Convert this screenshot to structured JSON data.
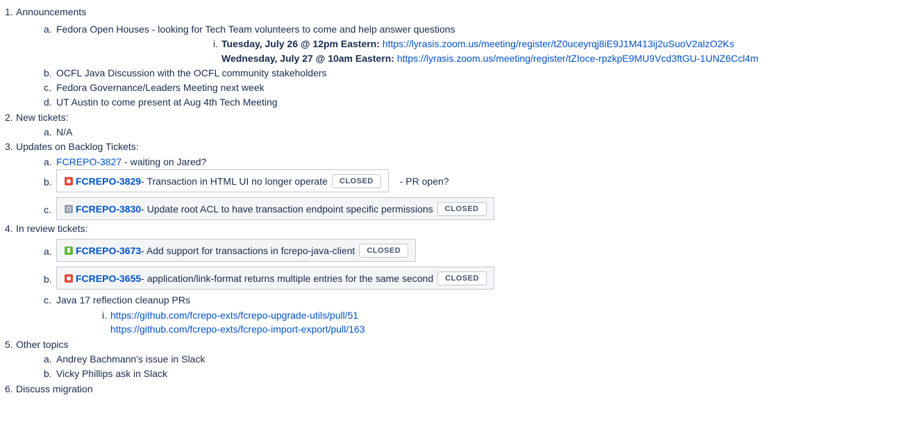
{
  "agenda": {
    "item1": {
      "num": "1.",
      "label": "Announcements",
      "a": {
        "num": "a.",
        "text": "Fedora Open Houses - looking for Tech Team volunteers to come and help answer questions"
      },
      "i": {
        "num": "i.",
        "tuesday_label": "Tuesday, July 26 @ 12pm Eastern:",
        "tuesday_url": "https://lyrasis.zoom.us/meeting/register/tZ0uceyrqj8iE9J1M413ij2uSuoV2alzO2Ks",
        "wednesday_label": "Wednesday, July 27 @ 10am Eastern:",
        "wednesday_url": "https://lyrasis.zoom.us/meeting/register/tZIoce-rpzkpE9MU9Vcd3ftGU-1UNZ6Ccl4m"
      },
      "b": {
        "num": "b.",
        "text": "OCFL Java Discussion with the OCFL community stakeholders"
      },
      "c": {
        "num": "c.",
        "text": "Fedora Governance/Leaders Meeting next week"
      },
      "d": {
        "num": "d.",
        "text": "UT Austin to come present at Aug 4th Tech Meeting"
      }
    },
    "item2": {
      "num": "2.",
      "label": "New tickets:",
      "a": {
        "num": "a.",
        "text": "N/A"
      }
    },
    "item3": {
      "num": "3.",
      "label": "Updates on Backlog Tickets:",
      "a": {
        "num": "a.",
        "key": "FCREPO-3827",
        "text": " - waiting on Jared?"
      },
      "b": {
        "num": "b.",
        "key": "FCREPO-3829",
        "summary": " - Transaction in HTML UI no longer operate",
        "status": "CLOSED",
        "after": "- PR open?"
      },
      "c": {
        "num": "c.",
        "key": "FCREPO-3830",
        "summary": " - Update root ACL to have transaction endpoint specific permissions",
        "status": "CLOSED"
      }
    },
    "item4": {
      "num": "4.",
      "label": "In review tickets:",
      "a": {
        "num": "a.",
        "key": "FCREPO-3673",
        "summary": " - Add support for transactions in fcrepo-java-client",
        "status": "CLOSED"
      },
      "b": {
        "num": "b.",
        "key": "FCREPO-3655",
        "summary": " - application/link-format returns multiple entries for the same second",
        "status": "CLOSED"
      },
      "c": {
        "num": "c.",
        "text": "Java 17 reflection cleanup PRs"
      },
      "i": {
        "num": "i.",
        "url1": "https://github.com/fcrepo-exts/fcrepo-upgrade-utils/pull/51",
        "url2": "https://github.com/fcrepo-exts/fcrepo-import-export/pull/163"
      }
    },
    "item5": {
      "num": "5.",
      "label": "Other topics",
      "a": {
        "num": "a.",
        "text": "Andrey Bachmann's issue in Slack"
      },
      "b": {
        "num": "b.",
        "text": "Vicky Phillips ask in Slack"
      }
    },
    "item6": {
      "num": "6.",
      "label": "Discuss migration"
    }
  }
}
